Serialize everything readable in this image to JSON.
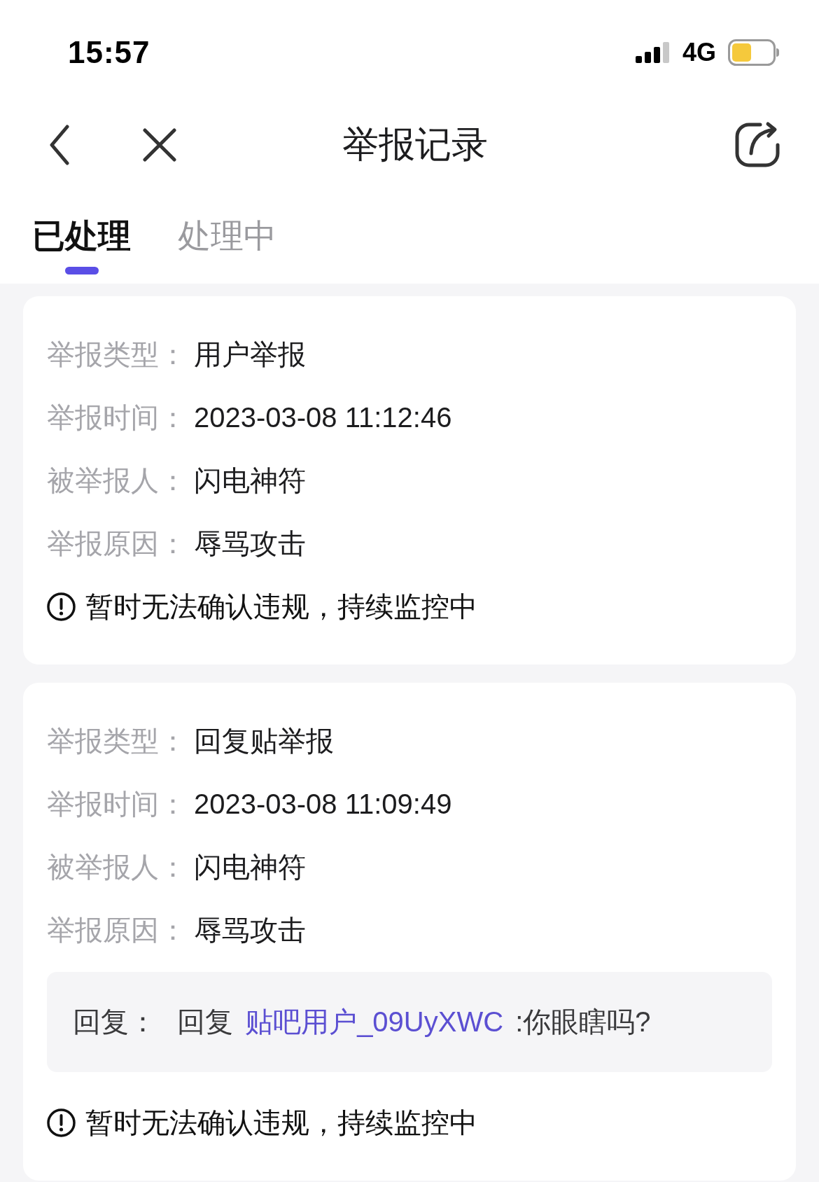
{
  "status_bar": {
    "time": "15:57",
    "network": "4G"
  },
  "nav_bar": {
    "title": "举报记录"
  },
  "tabs": [
    {
      "label": "已处理",
      "selected": true
    },
    {
      "label": "处理中",
      "selected": false
    }
  ],
  "reports": [
    {
      "fields": [
        {
          "label": "举报类型：",
          "value": "用户举报"
        },
        {
          "label": "举报时间：",
          "value": "2023-03-08 11:12:46"
        },
        {
          "label": "被举报人：",
          "value": "闪电神符"
        },
        {
          "label": "举报原因：",
          "value": "辱骂攻击"
        }
      ],
      "status": "暂时无法确认违规，持续监控中"
    },
    {
      "fields": [
        {
          "label": "举报类型：",
          "value": "回复贴举报"
        },
        {
          "label": "举报时间：",
          "value": "2023-03-08 11:09:49"
        },
        {
          "label": "被举报人：",
          "value": "闪电神符"
        },
        {
          "label": "举报原因：",
          "value": "辱骂攻击"
        }
      ],
      "reply": {
        "label": "回复：",
        "text_before": "回复",
        "link": "贴吧用户_09UyXWC",
        "text_after": ":你眼瞎吗?"
      },
      "status": "暂时无法确认违规，持续监控中"
    }
  ]
}
